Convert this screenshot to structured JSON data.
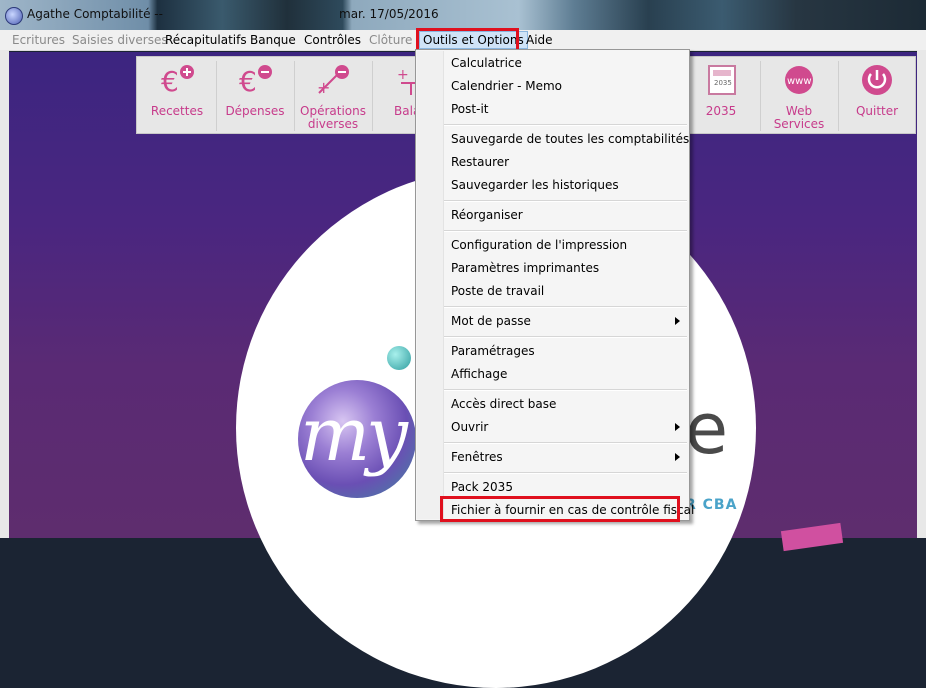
{
  "window": {
    "title": "Agathe Comptabilité  --",
    "date": "mar. 17/05/2016"
  },
  "menubar": {
    "items": [
      {
        "label": "Ecritures",
        "enabled": false
      },
      {
        "label": "Saisies diverses",
        "enabled": false
      },
      {
        "label": "Récapitulatifs",
        "enabled": true
      },
      {
        "label": "Banque",
        "enabled": true
      },
      {
        "label": "Contrôles",
        "enabled": true
      },
      {
        "label": "Clôture",
        "enabled": false
      },
      {
        "label": "Outils et Options",
        "enabled": true,
        "open": true
      },
      {
        "label": "Aide",
        "enabled": true
      }
    ]
  },
  "toolbar": {
    "buttons": [
      {
        "label": "Recettes",
        "icon": "euro-plus-icon"
      },
      {
        "label": "Dépenses",
        "icon": "euro-minus-icon"
      },
      {
        "label": "Opérations diverses",
        "icon": "plus-minus-icon"
      },
      {
        "label": "Balan",
        "icon": "balance-icon"
      },
      {
        "label": "2035",
        "icon": "form-2035-icon"
      },
      {
        "label": "Web Services",
        "icon": "www-globe-icon"
      },
      {
        "label": "Quitter",
        "icon": "power-icon"
      }
    ]
  },
  "dropdown": {
    "items": [
      {
        "label": "Calculatrice"
      },
      {
        "label": "Calendrier - Memo"
      },
      {
        "label": "Post-it"
      },
      {
        "label": "Sauvegarde de toutes les comptabilités"
      },
      {
        "label": "Restaurer"
      },
      {
        "label": "Sauvegarder les historiques"
      },
      {
        "label": "Réorganiser"
      },
      {
        "label": "Configuration de l'impression"
      },
      {
        "label": "Paramètres imprimantes"
      },
      {
        "label": "Poste de travail"
      },
      {
        "label": "Mot de passe",
        "submenu": true
      },
      {
        "label": "Paramétrages"
      },
      {
        "label": "Affichage"
      },
      {
        "label": "Accès direct base"
      },
      {
        "label": "Ouvrir",
        "submenu": true
      },
      {
        "label": "Fenêtres",
        "submenu": true
      },
      {
        "label": "Pack 2035"
      },
      {
        "label": "Fichier à fournir en cas de contrôle fiscal",
        "highlighted_box": true
      }
    ]
  },
  "logo": {
    "brand_fragment": "my",
    "brand_end": "e",
    "tagline_fragment": "R CBA"
  },
  "colors": {
    "accent": "#c73b8b",
    "highlight_box": "#e0101e",
    "workspace": "#4a2680"
  }
}
